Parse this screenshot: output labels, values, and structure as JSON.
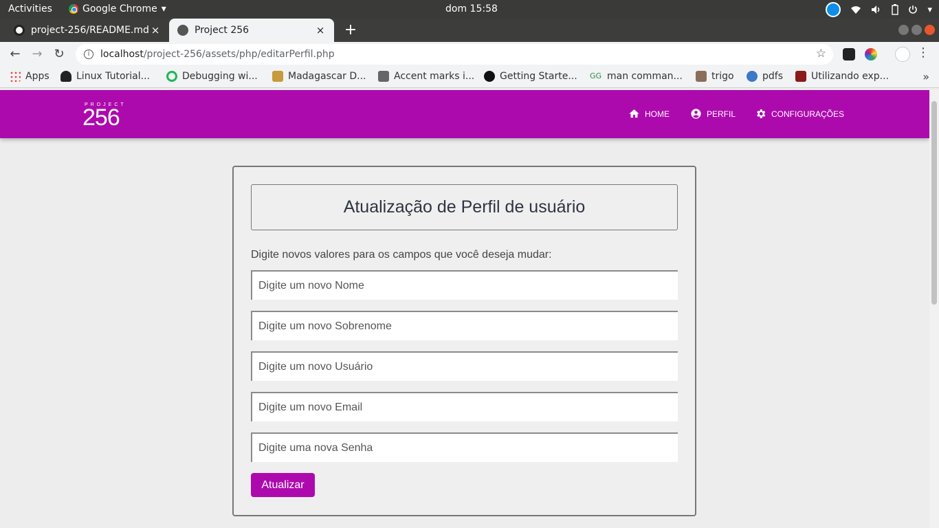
{
  "os": {
    "activities": "Activities",
    "app_name": "Google Chrome",
    "app_caret": "▾",
    "clock": "dom 15:58",
    "tray": [
      "wifi-icon",
      "volume-icon",
      "battery-icon",
      "power-menu-icon"
    ],
    "tray_caret": "▾"
  },
  "browser": {
    "tabs": [
      {
        "label": "project-256/README.md",
        "close": "×"
      },
      {
        "label": "Project 256",
        "close": "×"
      }
    ],
    "new_tab": "+",
    "url_host": "localhost",
    "url_path": "/project-256/assets/php/editarPerfil.php",
    "nav": {
      "back": "←",
      "forward": "→",
      "reload": "↻"
    },
    "bookmarks": [
      {
        "label": "Apps",
        "color": "#e8453c"
      },
      {
        "label": "Linux Tutorial...",
        "color": "#222222"
      },
      {
        "label": "Debugging wi...",
        "color": "#1db954"
      },
      {
        "label": "Madagascar D...",
        "color": "#c79a3c"
      },
      {
        "label": "Accent marks i...",
        "color": "#666666"
      },
      {
        "label": "Getting Starte...",
        "color": "#111111"
      },
      {
        "label": "man comman...",
        "color": "#2f8d46"
      },
      {
        "label": "trigo",
        "color": "#8b6d5c"
      },
      {
        "label": "pdfs",
        "color": "#3b78c8"
      },
      {
        "label": "Utilizando exp...",
        "color": "#8b1a1a"
      }
    ],
    "bookmarks_more": "»"
  },
  "site": {
    "brand_color": "#ad0aae",
    "logo_small": "PROJECT",
    "logo_big": "256",
    "nav": [
      {
        "label": "HOME",
        "icon": "home-icon"
      },
      {
        "label": "PERFIL",
        "icon": "account-icon"
      },
      {
        "label": "CONFIGURAÇÕES",
        "icon": "gear-icon"
      }
    ]
  },
  "form": {
    "title": "Atualização de Perfil de usuário",
    "instruction": "Digite novos valores para os campos que você deseja mudar:",
    "fields": [
      {
        "placeholder": "Digite um novo Nome"
      },
      {
        "placeholder": "Digite um novo Sobrenome"
      },
      {
        "placeholder": "Digite um novo Usuário"
      },
      {
        "placeholder": "Digite um novo Email"
      },
      {
        "placeholder": "Digite uma nova Senha"
      }
    ],
    "submit": "Atualizar"
  }
}
